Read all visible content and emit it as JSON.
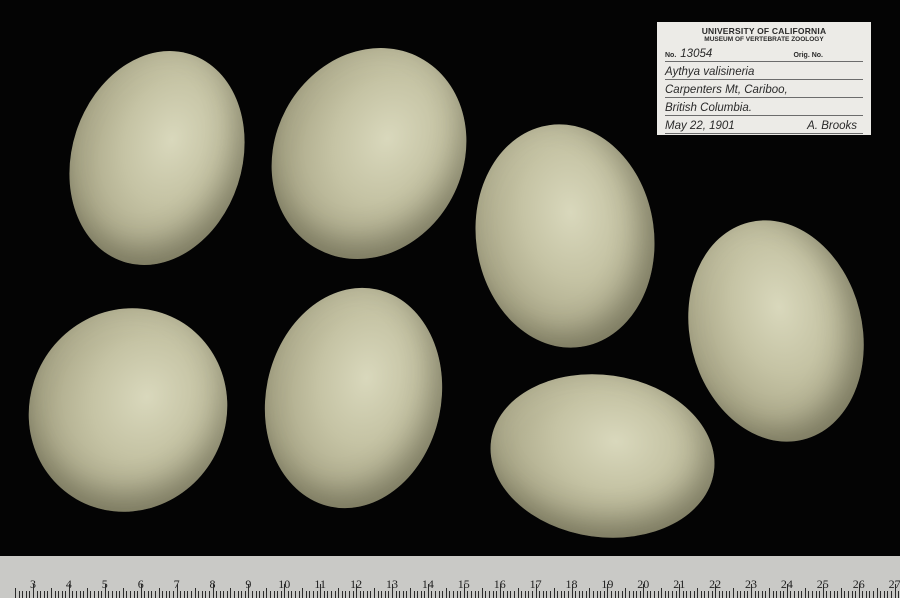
{
  "specimen": {
    "institution": "UNIVERSITY OF CALIFORNIA",
    "museum": "MUSEUM OF VERTEBRATE ZOOLOGY",
    "no_label": "No.",
    "number": "13054",
    "orig_no_label": "Orig. No.",
    "species": "Aythya valisineria",
    "locality_line1": "Carpenters Mt, Cariboo,",
    "locality_line2": "British Columbia.",
    "date": "May 22, 1901",
    "collector": "A. Brooks"
  },
  "ruler": {
    "labels": [
      "3",
      "4",
      "5",
      "6",
      "7",
      "8",
      "9",
      "10",
      "11",
      "12",
      "13",
      "14",
      "15",
      "16",
      "17",
      "18",
      "19",
      "20",
      "21",
      "22",
      "23",
      "24",
      "25",
      "26",
      "27"
    ]
  },
  "colors": {
    "background": "#040404",
    "egg": "#c5c3a4",
    "label": "#ecebe7",
    "ruler": "#c9c9c6"
  }
}
